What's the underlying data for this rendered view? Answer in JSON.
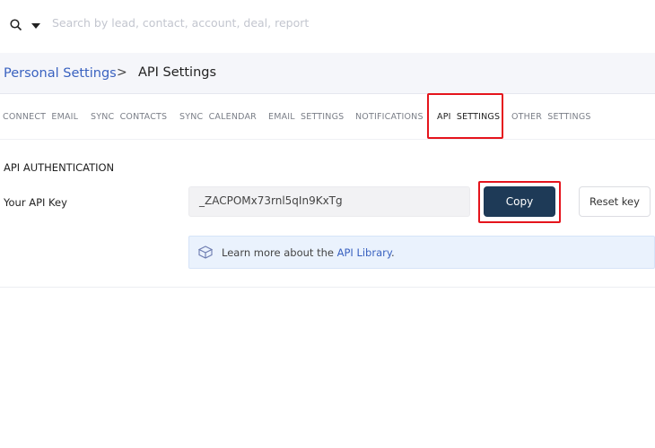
{
  "header": {
    "search_placeholder": "Search by lead, contact, account, deal, report",
    "search_icon": "search-icon",
    "dropdown_icon": "caret-down-icon"
  },
  "breadcrumb": {
    "parent": "Personal Settings",
    "separator": ">",
    "current": "API Settings"
  },
  "tabs": [
    {
      "label": "CONNECT EMAIL"
    },
    {
      "label": "SYNC CONTACTS"
    },
    {
      "label": "SYNC CALENDAR"
    },
    {
      "label": "EMAIL SETTINGS"
    },
    {
      "label": "NOTIFICATIONS"
    },
    {
      "label": "API SETTINGS",
      "active": true
    },
    {
      "label": "OTHER SETTINGS"
    }
  ],
  "section": {
    "title": "API AUTHENTICATION",
    "key_label": "Your API Key",
    "key_value": "_ZACPOMx73rnl5qIn9KxTg",
    "copy_label": "Copy",
    "reset_label": "Reset key"
  },
  "info": {
    "prefix": "Learn more about the ",
    "link": "API Library",
    "suffix": "."
  },
  "colors": {
    "accent": "#3a62c0",
    "primary_button": "#1e3a57",
    "highlight": "#e5141c",
    "info_bg": "#eaf2fd"
  }
}
